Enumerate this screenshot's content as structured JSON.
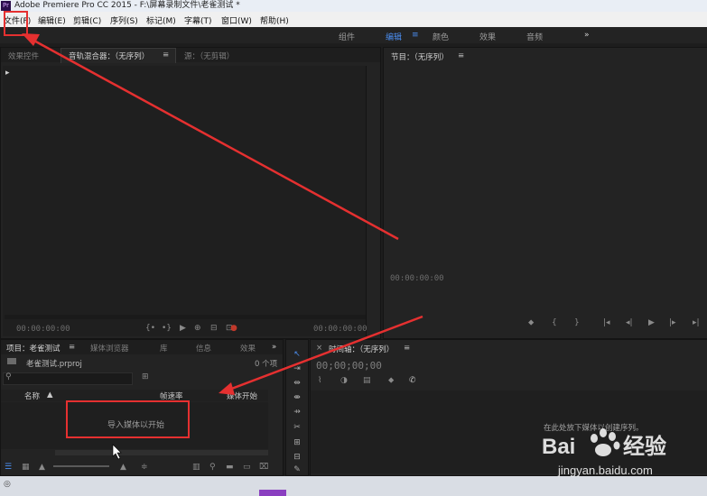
{
  "window": {
    "title": "Adobe Premiere Pro CC 2015 - F:\\屏幕录制文件\\老雀测试 *",
    "logo": "Pr"
  },
  "menu": [
    "文件(F)",
    "编辑(E)",
    "剪辑(C)",
    "序列(S)",
    "标记(M)",
    "字幕(T)",
    "窗口(W)",
    "帮助(H)"
  ],
  "workspaces": {
    "items": [
      "组件",
      "编辑",
      "颜色",
      "效果",
      "音频"
    ],
    "active": "编辑",
    "more": "»",
    "menu": "≡"
  },
  "source_panel": {
    "tabs": [
      "效果控件",
      "音轨混合器：（无序列）",
      "源：（无剪辑）"
    ],
    "active_tab": "音轨混合器：（无序列）",
    "menu": "≡",
    "timecode_left": "00:00:00:00",
    "timecode_right": "00:00:00:00",
    "expand": "▸"
  },
  "program_panel": {
    "title": "节目：（无序列）",
    "menu": "≡",
    "timecode": "00:00:00:00"
  },
  "project_panel": {
    "tabs": [
      "项目：老雀测试",
      "媒体浏览器",
      "库",
      "信息",
      "效果"
    ],
    "active_tab": "项目：老雀测试",
    "menu": "≡",
    "more": "»",
    "file": "老雀测试.prproj",
    "item_count": "0 个项",
    "columns": [
      "名称",
      "帧速率",
      "媒体开始"
    ],
    "sort": "▲",
    "empty_message": "导入媒体以开始"
  },
  "timeline_panel": {
    "title": "时间轴：（无序列）",
    "menu": "≡",
    "close": "×",
    "timecode": "00;00;00;00",
    "drop_hint": "在此处放下媒体以创建序列。"
  },
  "watermark": {
    "brand": "Bai 经验",
    "url": "jingyan.baidu.com"
  },
  "colors": {
    "accent": "#4b8ef0",
    "annotation": "#e53030",
    "panel": "#232323",
    "record": "#c0392b"
  },
  "icons": {
    "source_controls": [
      "mark-in-icon",
      "mark-out-icon",
      "play-icon",
      "insert-icon",
      "overwrite-icon",
      "export-frame-icon",
      "record-icon"
    ],
    "program_controls": [
      "marker-icon",
      "mark-in-icon",
      "mark-out-icon",
      "go-to-in-icon",
      "step-back-icon",
      "play-icon",
      "step-forward-icon",
      "go-to-out-icon"
    ],
    "tools": [
      "selection-tool-icon",
      "track-select-tool-icon",
      "ripple-edit-tool-icon",
      "rolling-edit-tool-icon",
      "rate-stretch-tool-icon",
      "razor-tool-icon",
      "slip-tool-icon",
      "slide-tool-icon",
      "pen-tool-icon",
      "hand-tool-icon"
    ],
    "timeline_controls": [
      "snap-icon",
      "linked-selection-icon",
      "add-marker-icon",
      "timeline-settings-icon",
      "wrench-icon"
    ]
  }
}
